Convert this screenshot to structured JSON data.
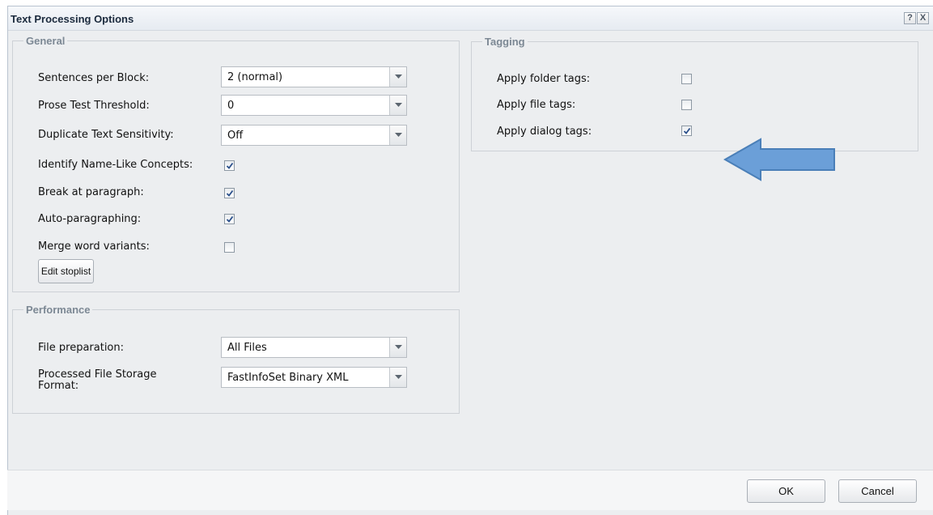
{
  "dialog": {
    "title": "Text Processing Options",
    "help_label": "?",
    "close_label": "X"
  },
  "general": {
    "legend": "General",
    "sentences_per_block": {
      "label": "Sentences per Block:",
      "value": "2 (normal)"
    },
    "prose_test_threshold": {
      "label": "Prose Test Threshold:",
      "value": "0"
    },
    "duplicate_text_sensitivity": {
      "label": "Duplicate Text Sensitivity:",
      "value": "Off"
    },
    "identify_name_like": {
      "label": "Identify Name-Like Concepts:",
      "checked": true
    },
    "break_at_paragraph": {
      "label": "Break at paragraph:",
      "checked": true
    },
    "auto_paragraphing": {
      "label": "Auto-paragraphing:",
      "checked": true
    },
    "merge_word_variants": {
      "label": "Merge word variants:",
      "checked": false
    },
    "edit_stoplist_label": "Edit stoplist"
  },
  "performance": {
    "legend": "Performance",
    "file_preparation": {
      "label": "File preparation:",
      "value": "All Files"
    },
    "storage_format": {
      "label": "Processed File Storage Format:",
      "value": "FastInfoSet Binary XML"
    }
  },
  "tagging": {
    "legend": "Tagging",
    "apply_folder_tags": {
      "label": "Apply folder tags:",
      "checked": false
    },
    "apply_file_tags": {
      "label": "Apply file tags:",
      "checked": false
    },
    "apply_dialog_tags": {
      "label": "Apply dialog tags:",
      "checked": true
    }
  },
  "footer": {
    "ok_label": "OK",
    "cancel_label": "Cancel"
  },
  "annotation": {
    "arrow_color": "#6b9fd8",
    "arrow_border_color": "#4a7fb8"
  }
}
